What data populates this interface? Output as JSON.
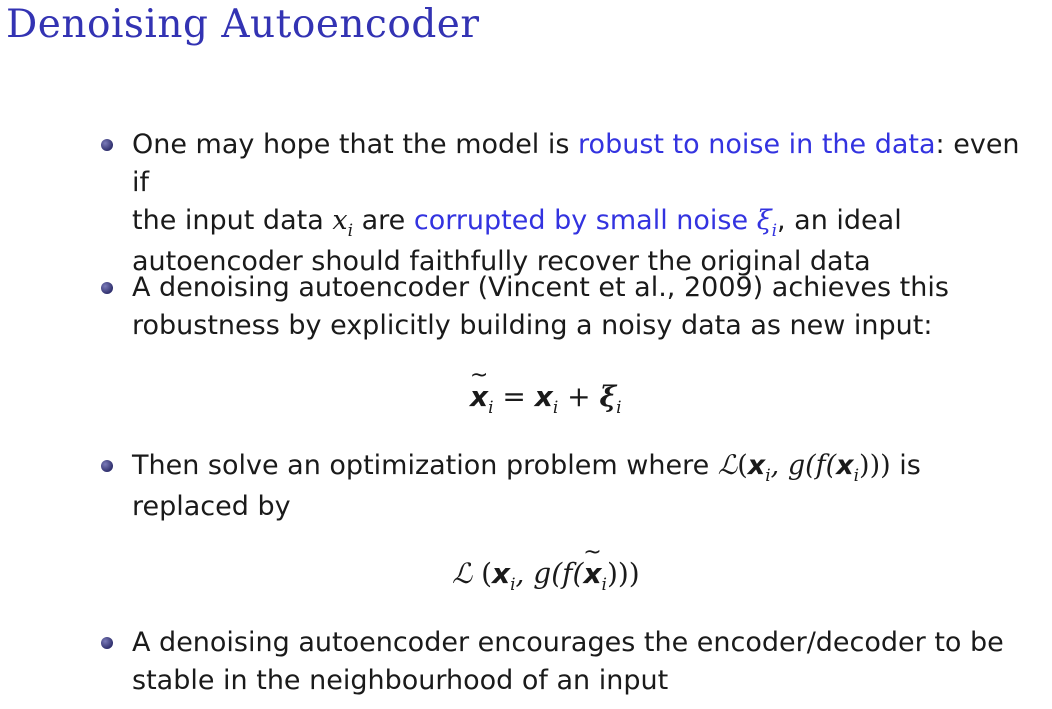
{
  "slide": {
    "title": "Denoising Autoencoder"
  },
  "bullets": {
    "b1": {
      "p1": "One may hope that the model is ",
      "h1": "robust to noise in the data",
      "p2": ": even if",
      "line2_a": "the input data ",
      "x": "x",
      "i": "i",
      "line2_b": " are ",
      "h2": "corrupted by small noise ",
      "xi": "ξ",
      "xi_sub": "i",
      "line2_c": ", an ideal",
      "line3": "autoencoder should faithfully recover the original data"
    },
    "b2": {
      "line1": "A denoising autoencoder (Vincent et al., 2009) achieves this",
      "line2": "robustness by explicitly building a noisy data as new input:"
    },
    "eq1": {
      "lhs": "x",
      "lhs_sub": "i",
      "equals": " = ",
      "x": "x",
      "x_sub": "i",
      "plus": " + ",
      "xi": "ξ",
      "xi_sub": "i"
    },
    "b3": {
      "line1_a": "Then solve an optimization problem where ",
      "L": "ℒ",
      "open": "(",
      "x": "x",
      "x_sub": "i",
      "mid": ", g(f(",
      "x2": "x",
      "x2_sub": "i",
      "close": ")))",
      "line1_b": " is",
      "line2": "replaced by"
    },
    "eq2": {
      "L": "ℒ",
      "open": " (",
      "x": "x",
      "x_sub": "i",
      "mid": ", g(f(",
      "xt": "x",
      "xt_sub": "i",
      "close": ")))"
    },
    "b4": {
      "line1": "A denoising autoencoder encourages the encoder/decoder to be",
      "line2": "stable in the neighbourhood of an input"
    }
  }
}
